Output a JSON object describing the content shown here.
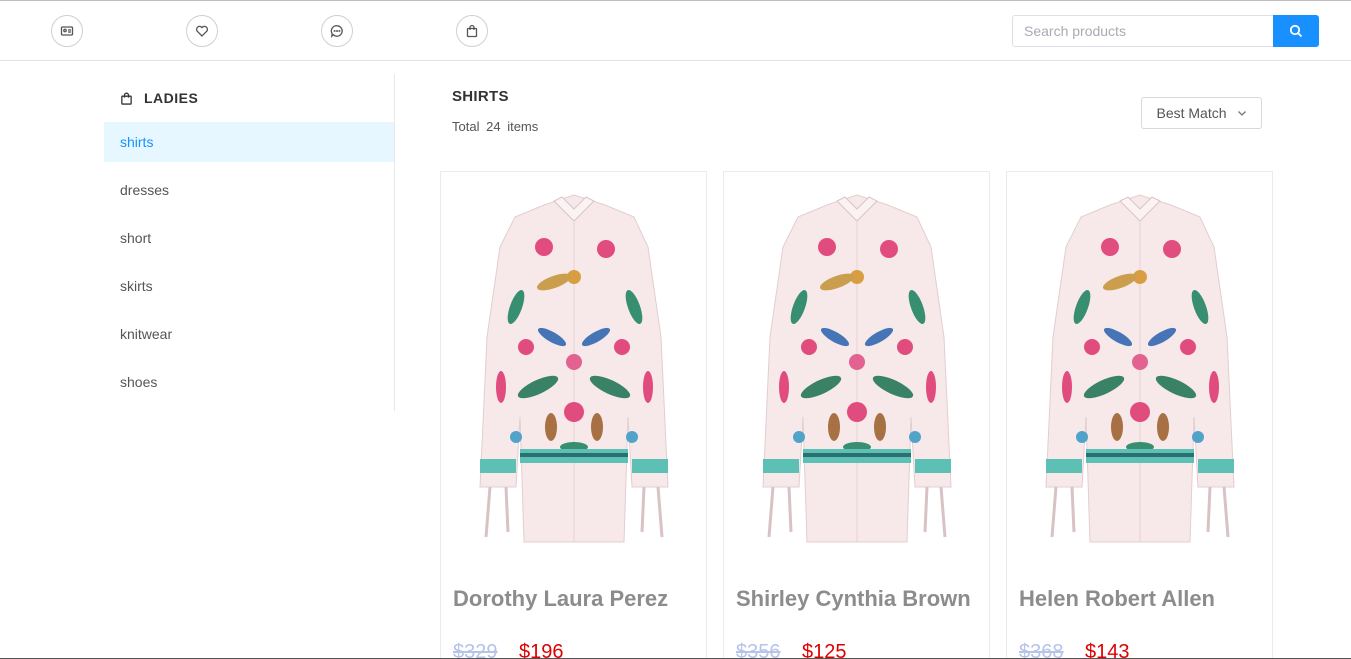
{
  "header": {
    "icons": [
      "id-card-icon",
      "heart-icon",
      "chat-icon",
      "shopping-bag-icon"
    ],
    "search_placeholder": "Search products",
    "accent_color": "#1890ff"
  },
  "sidebar": {
    "title": "LADIES",
    "items": [
      {
        "label": "shirts",
        "active": true
      },
      {
        "label": "dresses",
        "active": false
      },
      {
        "label": "short",
        "active": false
      },
      {
        "label": "skirts",
        "active": false
      },
      {
        "label": "knitwear",
        "active": false
      },
      {
        "label": "shoes",
        "active": false
      }
    ]
  },
  "main": {
    "title": "SHIRTS",
    "total_prefix": "Total",
    "total_count": "24",
    "total_suffix": "items",
    "sort_label": "Best Match",
    "products": [
      {
        "name": "Dorothy Laura Perez",
        "old_price": "$329",
        "price": "$196"
      },
      {
        "name": "Shirley Cynthia Brown",
        "old_price": "$356",
        "price": "$125"
      },
      {
        "name": "Helen Robert Allen",
        "old_price": "$368",
        "price": "$143"
      }
    ]
  }
}
